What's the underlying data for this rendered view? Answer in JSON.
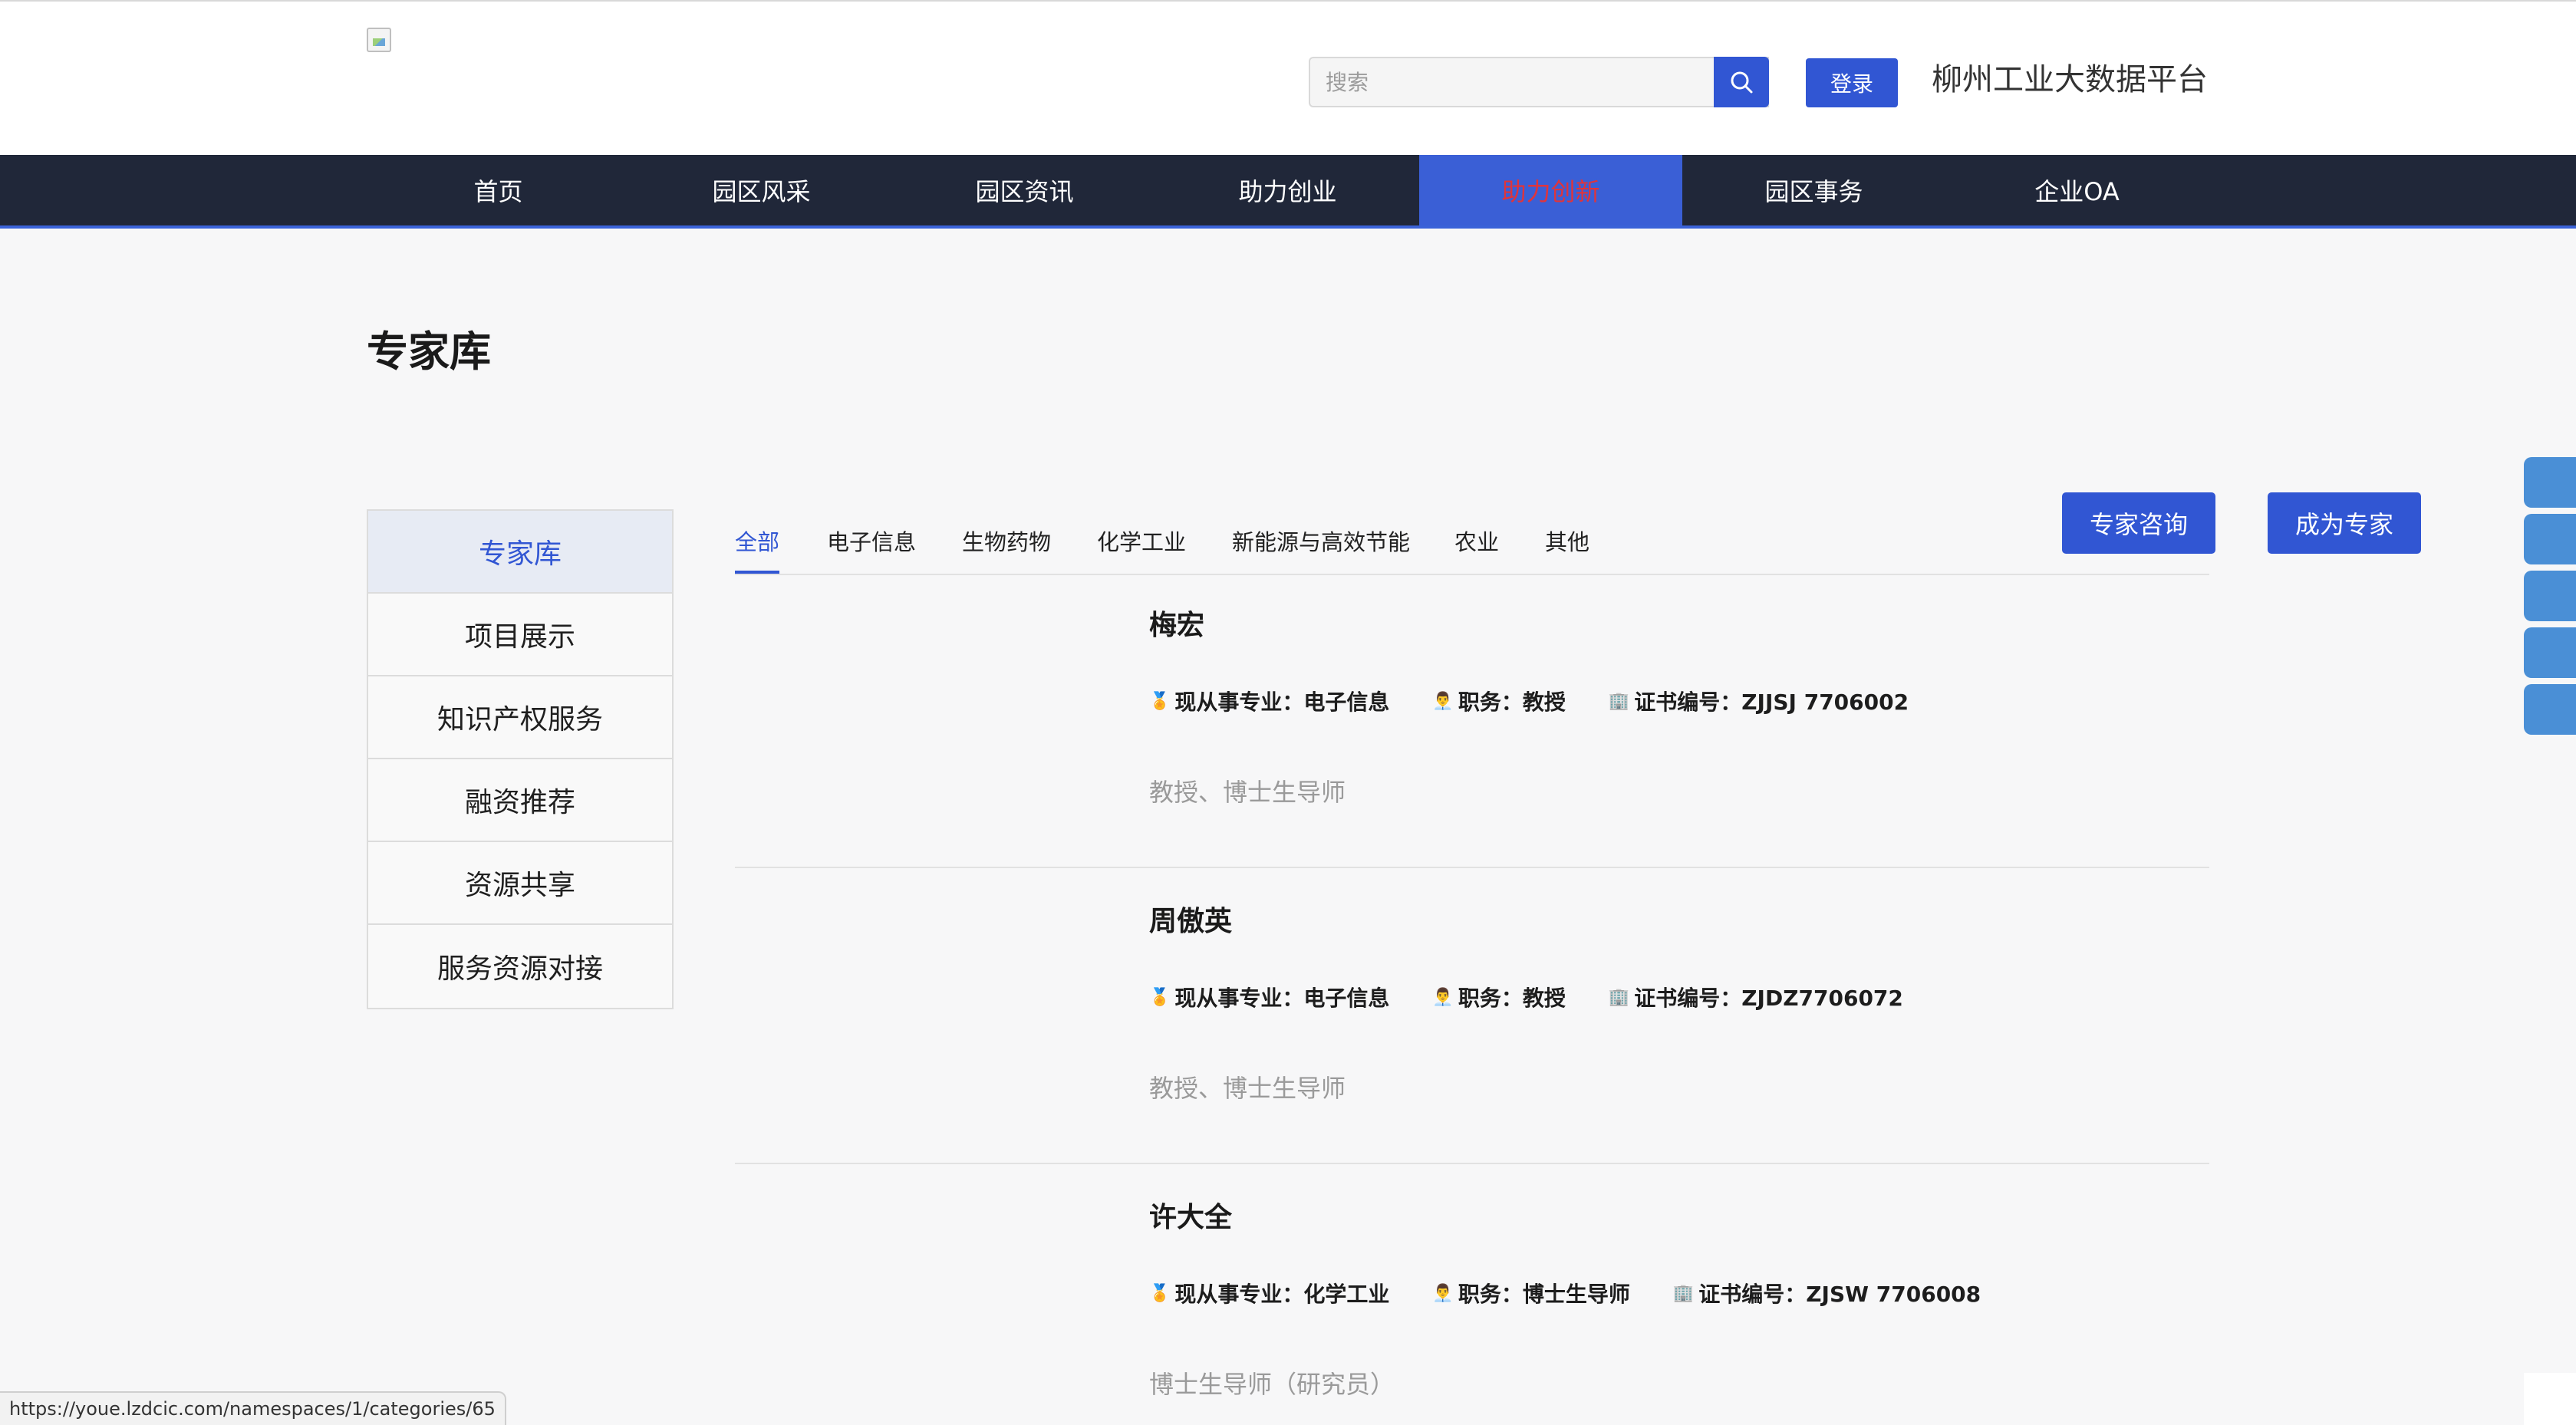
{
  "header": {
    "search_placeholder": "搜索",
    "login_label": "登录",
    "platform_name": "柳州工业大数据平台"
  },
  "nav": {
    "items": [
      "首页",
      "园区风采",
      "园区资讯",
      "助力创业",
      "助力创新",
      "园区事务",
      "企业OA"
    ],
    "active_index": 4
  },
  "page": {
    "title": "专家库"
  },
  "sidebar": {
    "items": [
      "专家库",
      "项目展示",
      "知识产权服务",
      "融资推荐",
      "资源共享",
      "服务资源对接"
    ],
    "active_index": 0
  },
  "tabs": {
    "items": [
      "全部",
      "电子信息",
      "生物药物",
      "化学工业",
      "新能源与高效节能",
      "农业",
      "其他"
    ],
    "active_index": 0
  },
  "actions": {
    "consult_label": "专家咨询",
    "become_label": "成为专家"
  },
  "experts": [
    {
      "name": "梅宏",
      "major": "现从事专业：电子信息",
      "position": "职务：教授",
      "cert": "证书编号：ZJJSJ 7706002",
      "desc": "教授、博士生导师"
    },
    {
      "name": "周傲英",
      "major": "现从事专业：电子信息",
      "position": "职务：教授",
      "cert": "证书编号：ZJDZ7706072",
      "desc": "教授、博士生导师"
    },
    {
      "name": "许大全",
      "major": "现从事专业：化学工业",
      "position": "职务：博士生导师",
      "cert": "证书编号：ZJSW 7706008",
      "desc": "博士生导师（研究员）"
    }
  ],
  "icons": {
    "major": "medal-icon",
    "position": "person-icon",
    "cert": "building-icon"
  },
  "colors": {
    "primary": "#3156d3",
    "nav_bg": "#202739",
    "nav_active_text": "#e0343b",
    "float_btn": "#4a8fd6"
  },
  "status_url": "https://youe.lzdcic.com/namespaces/1/categories/65"
}
